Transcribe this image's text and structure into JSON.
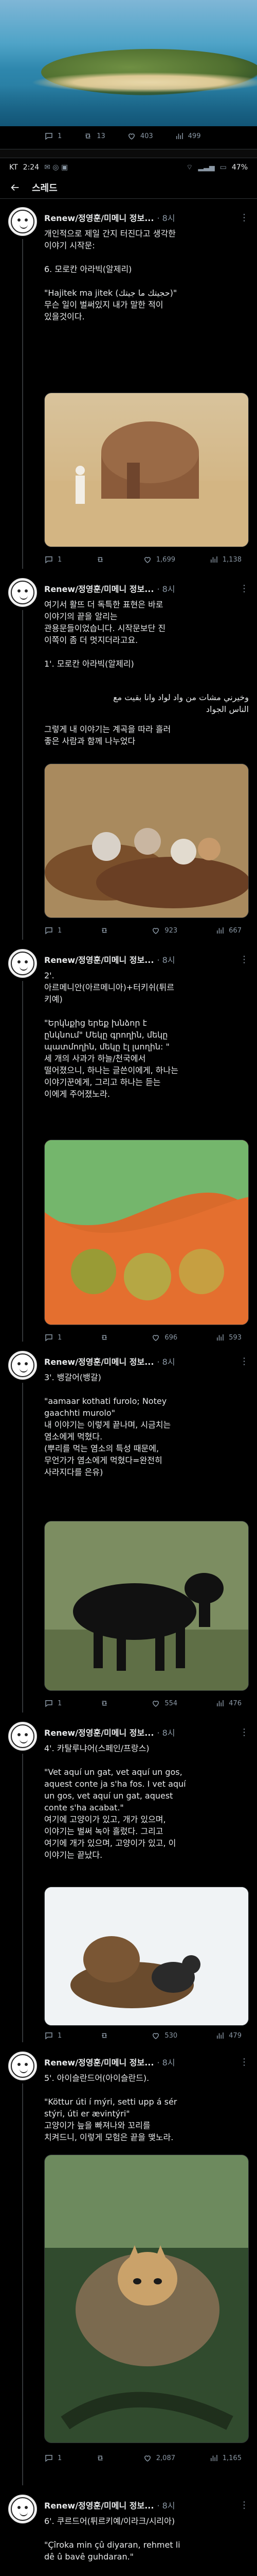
{
  "top_card": {
    "stats": {
      "reply": "1",
      "retweet": "13",
      "like": "403",
      "views": "499"
    }
  },
  "statusbar": {
    "time": "2:24",
    "carrier": "KT",
    "battery": "47%"
  },
  "thread_header": {
    "title": "스레드"
  },
  "posts": [
    {
      "name": "Renew/정영훈/미메니 정보...",
      "time": "· 8시",
      "text": "개인적으로 제일 간지 터진다고 생각한\n이야기 시작문:\n\n6. 모로칸 아라빅(알제리)\n\n\"Hajitek ma jitek (حجيتك ما جيتك)\"\n무슨 일이 벌써있지 내가 말한 적이\n있을것이다.",
      "stats": {
        "reply": "1",
        "retweet": "",
        "like": "1,699",
        "views": "1,138"
      }
    },
    {
      "name": "Renew/정영훈/미메니 정보...",
      "time": "· 8시",
      "text": "여기서 활뜨 더 독특한 표현은 바로\n이야기의 끝을 알리는\n관용문들이었습니다. 시작문보단 진\n이쪽이 좀 더 멋지더라고요.\n\n1'. 모로칸 아라빅(알제리)",
      "arabic": "وخيرني مشات من واد لواد وانا بقيت مع\nالناس الجواد",
      "text2": "그렇게 내 이야기는 계곡을 따라 흘러\n좋은 사람과 함께 나누었다",
      "stats": {
        "reply": "1",
        "retweet": "",
        "like": "923",
        "views": "667"
      }
    },
    {
      "name": "Renew/정영훈/미메니 정보...",
      "time": "· 8시",
      "text": "2'.\n아르메니안(아르메니아)+터키쉬(튀르\n키예)\n\n\"Երկնքից երեք խնձոր է\nընկնում\" Մեկը գրողին, մեկը\nպատմողին, մեկը էլ լսողին: \"\n세 개의 사과가 하늘/천국에서\n떨어졌으니, 하나는 글쓴이에게, 하나는\n이야기꾼에게, 그리고 하나는 듣는\n이에게 주어졌노라.",
      "stats": {
        "reply": "1",
        "retweet": "",
        "like": "696",
        "views": "593"
      }
    },
    {
      "name": "Renew/정영훈/미메니 정보...",
      "time": "· 8시",
      "text": "3'. 뱅갈어(뱅갈)\n\n\"aamaar kothati furolo; Notey\ngaachhti murolo\"\n내 이야기는 이렇게 끝나며, 시금치는\n염소에게 먹혔다.\n(뿌리를 먹는 염소의 특성 때문에,\n무언가가 염소에게 먹혔다=완전히\n사라지다를 은유)",
      "stats": {
        "reply": "1",
        "retweet": "",
        "like": "554",
        "views": "476"
      }
    },
    {
      "name": "Renew/정영훈/미메니 정보...",
      "time": "· 8시",
      "text": "4'. 카탈루냐어(스페인/프랑스)\n\n\"Vet aquí un gat, vet aquí un gos,\naquest conte ja s'ha fos. I vet aquí\nun gos, vet aquí un gat, aquest\nconte s'ha acabat.\"\n여기에 고양이가 있고, 개가 있으며,\n이야기는 벌써 녹아 흘렀다. 그리고\n여기에 개가 있으며, 고양이가 있고, 이\n이야기는 끝났다.",
      "stats": {
        "reply": "1",
        "retweet": "",
        "like": "530",
        "views": "479"
      }
    },
    {
      "name": "Renew/정영훈/미메니 정보...",
      "time": "· 8시",
      "text": "5'. 아이슬란드어(아이슬란드).\n\n\"Köttur úti í mýri, setti upp á sér\nstýri, úti er ævintýri\"\n고양이가 늪을 빠져나와 꼬리를\n치켜드니, 이렇게 모험은 끝을 맺노라.",
      "stats": {
        "reply": "1",
        "retweet": "",
        "like": "2,087",
        "views": "1,165"
      }
    },
    {
      "name": "Renew/정영훈/미메니 정보...",
      "time": "· 8시",
      "text": "6'. 쿠르드어(튀르키예/이라크/시리아)\n\n\"Çîroka min çû diyaran, rehmet li\ndê û bavê guhdaran.\""
    }
  ]
}
